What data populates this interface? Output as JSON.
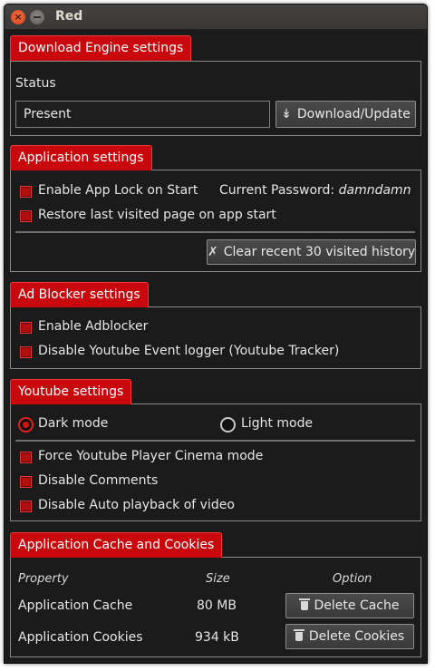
{
  "window": {
    "title": "Red"
  },
  "download_engine": {
    "header": "Download Engine settings",
    "status_label": "Status",
    "status_value": "Present",
    "update_button": "Download/Update",
    "update_icon": "double-chevron-down-icon"
  },
  "application_settings": {
    "header": "Application settings",
    "app_lock_label": "Enable App Lock on Start",
    "app_lock_checked": true,
    "password_label": "Current Password:",
    "password_value": "damndamn",
    "restore_label": "Restore last visited page on app start",
    "restore_checked": true,
    "clear_button": "Clear recent 30 visited history",
    "clear_icon": "x-icon"
  },
  "ad_blocker": {
    "header": "Ad Blocker settings",
    "enable_label": "Enable Adblocker",
    "enable_checked": true,
    "disable_logger_label": "Disable Youtube Event logger (Youtube Tracker)",
    "disable_logger_checked": true
  },
  "youtube_settings": {
    "header": "Youtube settings",
    "dark_mode_label": "Dark mode",
    "dark_mode_selected": true,
    "light_mode_label": "Light mode",
    "light_mode_selected": false,
    "cinema_label": "Force Youtube Player Cinema mode",
    "cinema_checked": true,
    "comments_label": "Disable Comments",
    "comments_checked": true,
    "autoplay_label": "Disable Auto playback of video",
    "autoplay_checked": true
  },
  "cache_cookies": {
    "header": "Application Cache and Cookies",
    "columns": {
      "property": "Property",
      "size": "Size",
      "option": "Option"
    },
    "rows": [
      {
        "property": "Application Cache",
        "size": "80 MB",
        "button": "Delete Cache"
      },
      {
        "property": "Application Cookies",
        "size": "934 kB",
        "button": "Delete Cookies"
      }
    ],
    "button_icon": "trash-icon"
  },
  "colors": {
    "accent": "#c8080c",
    "background": "#1b1b1b",
    "border": "#8a8a8a"
  }
}
